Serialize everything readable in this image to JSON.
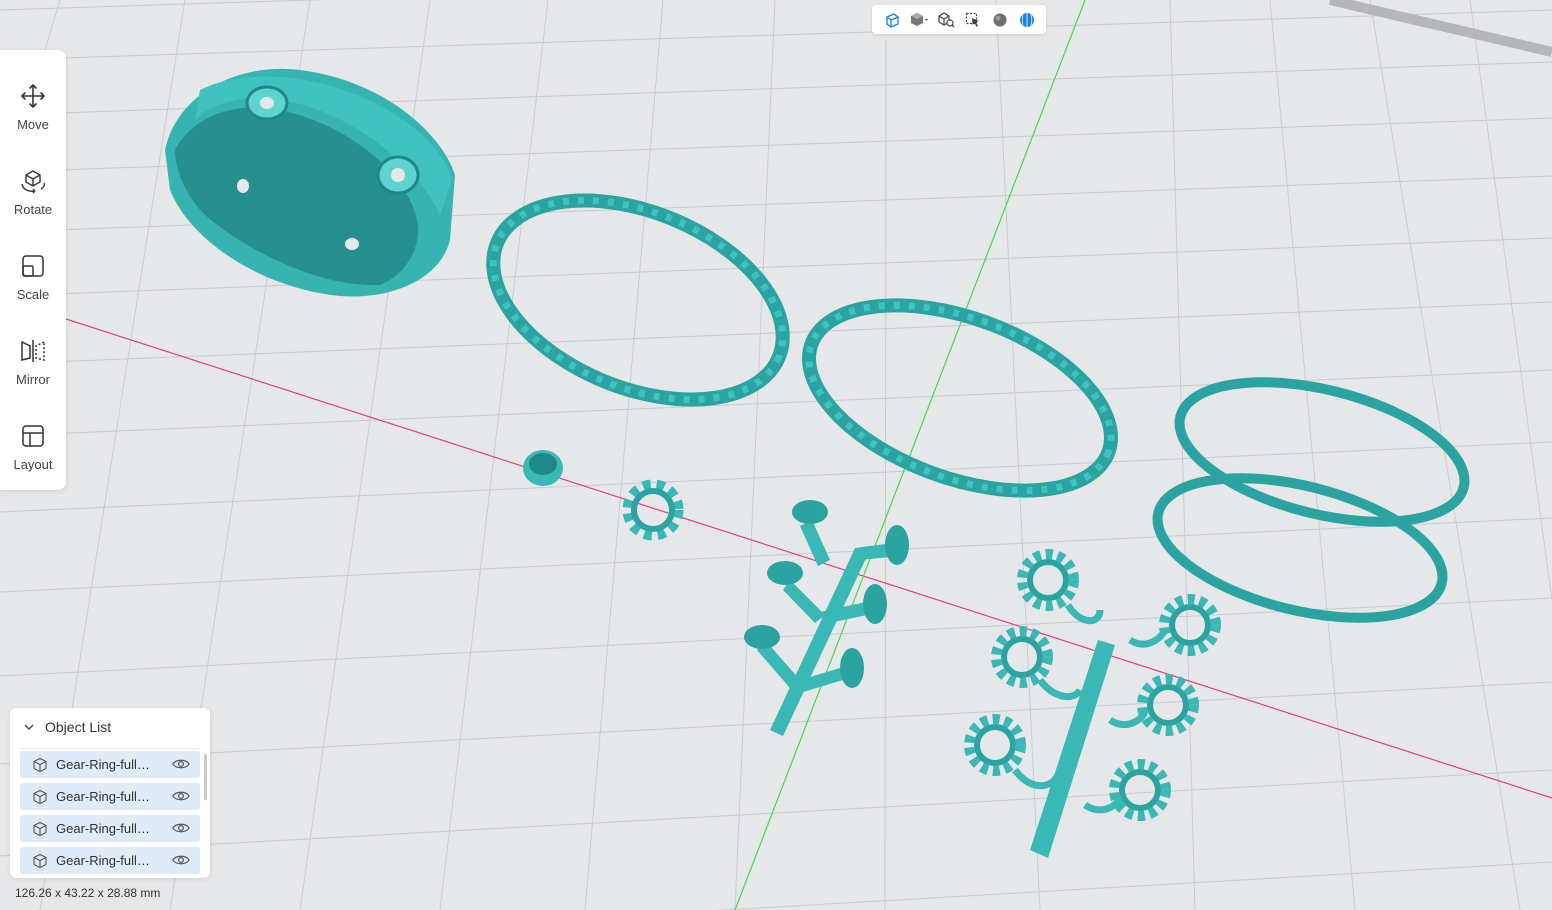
{
  "view_toolbar": {
    "buttons": [
      {
        "icon": "perspective-view-icon"
      },
      {
        "icon": "view-cube-dropdown-icon"
      },
      {
        "icon": "zoom-fit-icon"
      },
      {
        "icon": "select-cursor-icon"
      },
      {
        "icon": "shading-sphere-icon"
      },
      {
        "icon": "wireframe-mode-icon"
      }
    ]
  },
  "tools": [
    {
      "label": "Move",
      "icon": "move-arrows-icon"
    },
    {
      "label": "Rotate",
      "icon": "rotate-cube-icon"
    },
    {
      "label": "Scale",
      "icon": "scale-box-icon"
    },
    {
      "label": "Mirror",
      "icon": "mirror-icon"
    },
    {
      "label": "Layout",
      "icon": "layout-grid-icon"
    }
  ],
  "object_list": {
    "title": "Object List",
    "items": [
      {
        "name": "Gear-Ring-full…"
      },
      {
        "name": "Gear-Ring-full…"
      },
      {
        "name": "Gear-Ring-full…"
      },
      {
        "name": "Gear-Ring-full…"
      }
    ]
  },
  "dimensions": "126.26 x 43.22 x 28.88 mm",
  "colors": {
    "model": "#3ab8b6",
    "model_dark": "#1f8785",
    "model_light": "#5fd3d0",
    "background": "#e6e7e9",
    "grid": "#c8cacd",
    "x_axis": "#e0407a",
    "y_axis": "#4fd64f",
    "accent": "#1d7fe0"
  }
}
